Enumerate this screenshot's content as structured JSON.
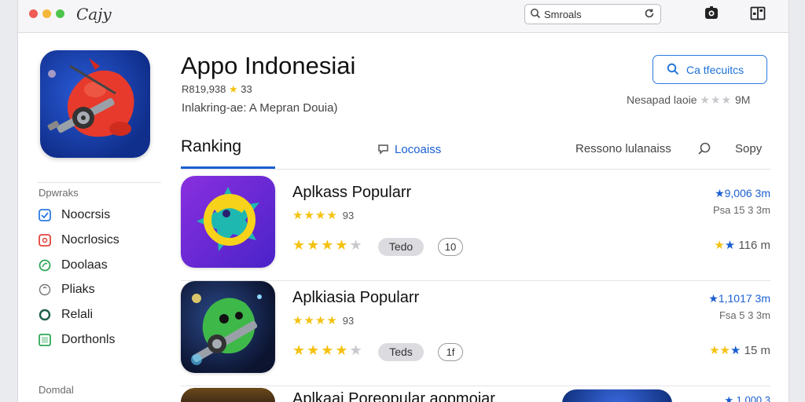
{
  "window": {
    "title": "Cajy"
  },
  "toolbar": {
    "search_value": "Smroals"
  },
  "app": {
    "name": "Appo Indonesiai",
    "meta_prefix": "R819,938",
    "meta_star": "★",
    "meta_suffix": "33",
    "subtitle": "Inlakring-ae: A Mepran Douia)",
    "cta_label": "Ca tfecuitcs",
    "right_meta_text": "Nesapad laoie",
    "right_meta_stars": "★★★",
    "right_meta_size": "9M"
  },
  "sidebar": {
    "heading": "Dpwraks",
    "items": [
      {
        "label": "Noocrsis",
        "icon": "checkbox-icon",
        "color": "#2d7be0"
      },
      {
        "label": "Nocrlosics",
        "icon": "badge-icon",
        "color": "#e0443a"
      },
      {
        "label": "Doolaas",
        "icon": "leaf-icon",
        "color": "#2fa857"
      },
      {
        "label": "Pliaks",
        "icon": "circle-icon",
        "color": "#777777"
      },
      {
        "label": "Relali",
        "icon": "ring-icon",
        "color": "#1f5f4a"
      },
      {
        "label": "Dorthonls",
        "icon": "check-square-icon",
        "color": "#2fa857"
      }
    ],
    "footer_heading": "Domdal"
  },
  "tabs": {
    "ranking": "Ranking",
    "loc": "Locoaiss",
    "res": "Ressono lulanaiss",
    "sort": "Sopy"
  },
  "rows": [
    {
      "title": "Aplkass Popularr",
      "stars": "★★★★",
      "count": "93",
      "stars2": "★★★★",
      "stars2_grey": "★",
      "tag": "Tedo",
      "num": "10",
      "price_star": "★",
      "price": "9,006 3m",
      "size": "Psa 15 3 3m",
      "rate_stars_yellow": "★",
      "rate_stars_blue": "★",
      "rate": "116 m"
    },
    {
      "title": "Aplkiasia Popularr",
      "stars": "★★★★",
      "count": "93",
      "stars2": "★★★★",
      "stars2_grey": "★",
      "tag": "Teds",
      "num": "1f",
      "price_star": "★",
      "price": "1,1017 3m",
      "size": "Fsa 5 3 3m",
      "rate_stars_yellow": "★★",
      "rate_stars_blue": "★",
      "rate": "15 m"
    }
  ],
  "partial": {
    "title": "Aplkaai Poreopular aopmoiar",
    "right": "★ 1,000 3"
  },
  "colors": {
    "accent": "#1a5fd0",
    "star": "#f5c211",
    "window_bg": "#ffffff"
  }
}
